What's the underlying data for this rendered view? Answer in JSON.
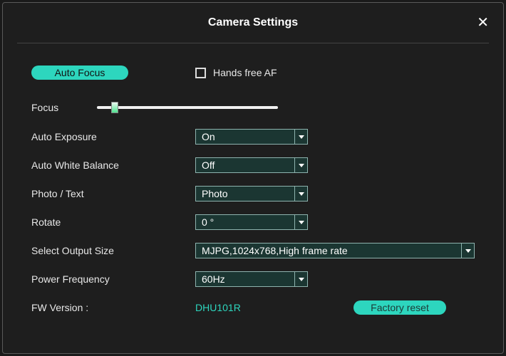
{
  "header": {
    "title": "Camera Settings",
    "close": "✕"
  },
  "buttons": {
    "auto_focus": "Auto Focus",
    "factory_reset": "Factory reset"
  },
  "checkbox": {
    "hands_free_af": "Hands free AF"
  },
  "labels": {
    "focus": "Focus",
    "auto_exposure": "Auto Exposure",
    "auto_white_balance": "Auto White Balance",
    "photo_text": "Photo / Text",
    "rotate": "Rotate",
    "select_output_size": "Select Output Size",
    "power_frequency": "Power Frequency",
    "fw_version": "FW Version :"
  },
  "values": {
    "auto_exposure": "On",
    "auto_white_balance": "Off",
    "photo_text": "Photo",
    "rotate": "0 °",
    "select_output_size": "MJPG,1024x768,High frame rate",
    "power_frequency": "60Hz",
    "fw_version": "DHU101R"
  },
  "slider": {
    "focus_percent": 8
  }
}
